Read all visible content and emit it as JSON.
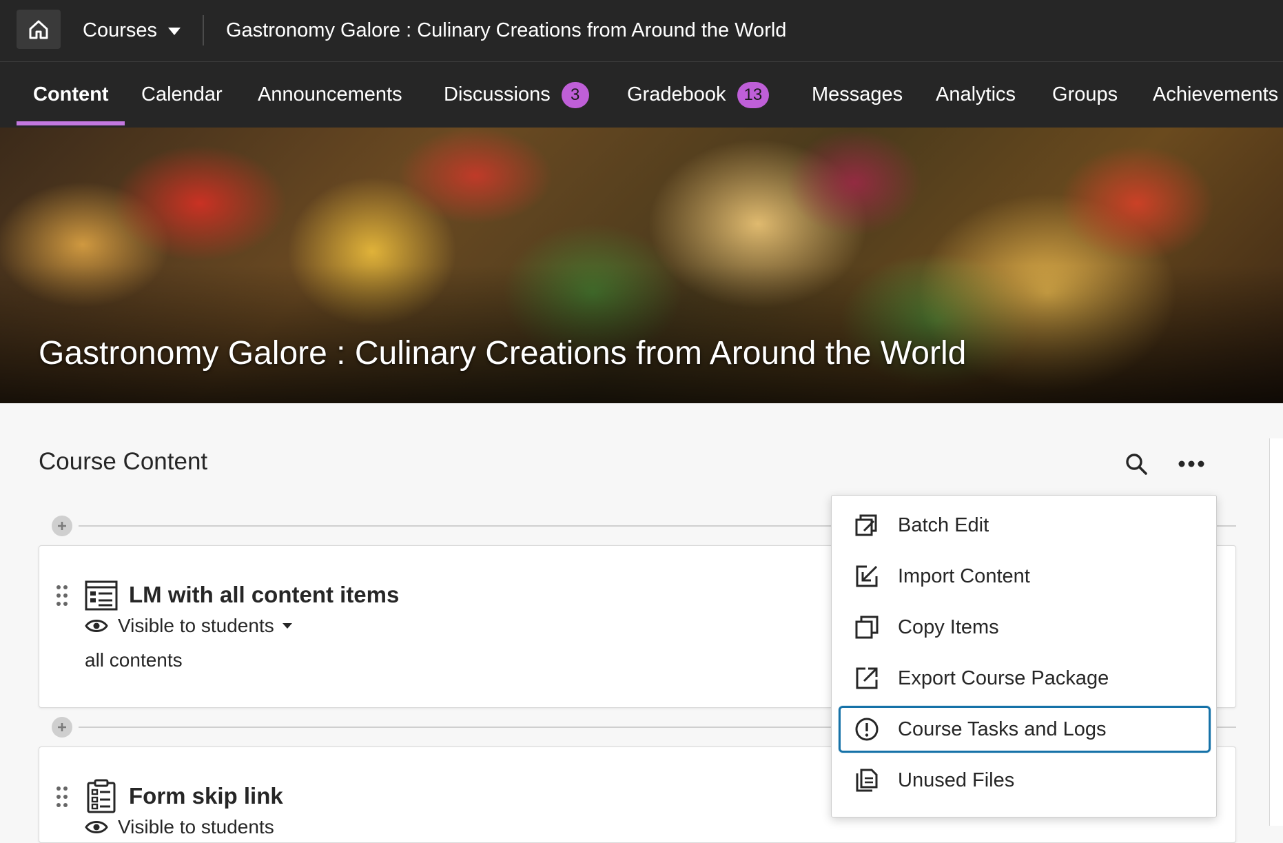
{
  "topbar": {
    "courses_label": "Courses",
    "course_title": "Gastronomy Galore : Culinary Creations from Around the World"
  },
  "nav": {
    "tabs": [
      {
        "label": "Content",
        "active": true
      },
      {
        "label": "Calendar"
      },
      {
        "label": "Announcements"
      },
      {
        "label": "Discussions",
        "badge": "3"
      },
      {
        "label": "Gradebook",
        "badge": "13"
      },
      {
        "label": "Messages"
      },
      {
        "label": "Analytics"
      },
      {
        "label": "Groups"
      },
      {
        "label": "Achievements"
      }
    ]
  },
  "banner": {
    "title": "Gastronomy Galore : Culinary Creations from Around the World"
  },
  "content": {
    "section_title": "Course Content",
    "items": [
      {
        "title": "LM with all content items",
        "icon": "learning-module-icon",
        "visibility": "Visible to students",
        "description": "all contents"
      },
      {
        "title": "Form skip link",
        "icon": "form-icon",
        "visibility": "Visible to students"
      }
    ]
  },
  "menu": {
    "items": [
      {
        "label": "Batch Edit",
        "icon": "batch-edit-icon"
      },
      {
        "label": "Import Content",
        "icon": "import-icon"
      },
      {
        "label": "Copy Items",
        "icon": "copy-icon"
      },
      {
        "label": "Export Course Package",
        "icon": "export-icon"
      },
      {
        "label": "Course Tasks and Logs",
        "icon": "alert-circle-icon",
        "focused": true
      },
      {
        "label": "Unused Files",
        "icon": "files-icon"
      }
    ]
  },
  "colors": {
    "topbar_bg": "#262626",
    "accent_purple": "#c378e0",
    "badge_bg": "#bf5fd8",
    "focus_blue": "#1672a8"
  }
}
